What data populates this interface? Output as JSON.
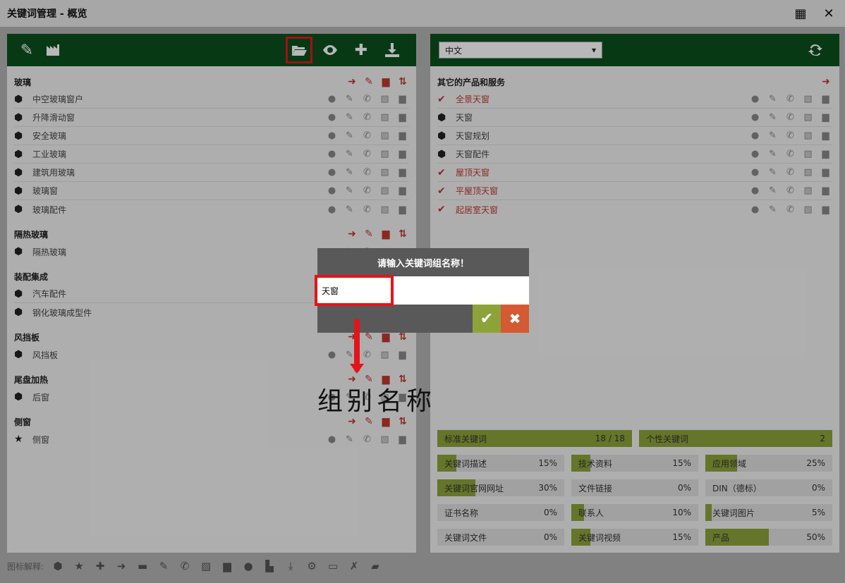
{
  "window": {
    "title": "关键词管理 - 概览"
  },
  "left_groups": [
    {
      "title": "玻璃",
      "items": [
        "中空玻璃窗户",
        "升降滑动窗",
        "安全玻璃",
        "工业玻璃",
        "建筑用玻璃",
        "玻璃窗",
        "玻璃配件"
      ]
    },
    {
      "title": "隔热玻璃",
      "items": [
        "隔热玻璃"
      ]
    },
    {
      "title": "装配集成",
      "items": [
        "汽车配件",
        "钢化玻璃成型件"
      ]
    },
    {
      "title": "风挡板",
      "items": [
        "风挡板"
      ]
    },
    {
      "title": "尾盘加热",
      "items": [
        "后窗"
      ]
    },
    {
      "title": "侧窗",
      "items": [
        "侧窗"
      ]
    }
  ],
  "right": {
    "language": "中文",
    "group_title": "其它的产品和服务",
    "items": [
      {
        "label": "全景天窗",
        "checked": true
      },
      {
        "label": "天窗",
        "checked": false
      },
      {
        "label": "天窗规划",
        "checked": false
      },
      {
        "label": "天窗配件",
        "checked": false
      },
      {
        "label": "屋顶天窗",
        "checked": true
      },
      {
        "label": "平屋顶天窗",
        "checked": true
      },
      {
        "label": "起居室天窗",
        "checked": true
      }
    ]
  },
  "stats": {
    "standard": {
      "label": "标准关键词",
      "value": "18 / 18",
      "fill": 1.0
    },
    "personal": {
      "label": "个性关键词",
      "value": "2",
      "fill": 1.0
    },
    "grid": [
      {
        "label": "关键词描述",
        "value": "15%",
        "fill": 0.15
      },
      {
        "label": "技术资料",
        "value": "15%",
        "fill": 0.15
      },
      {
        "label": "应用领域",
        "value": "25%",
        "fill": 0.25
      },
      {
        "label": "关键词官网网址",
        "value": "30%",
        "fill": 0.3
      },
      {
        "label": "文件链接",
        "value": "0%",
        "fill": 0
      },
      {
        "label": "DIN（德标）",
        "value": "0%",
        "fill": 0
      },
      {
        "label": "证书名称",
        "value": "0%",
        "fill": 0
      },
      {
        "label": "联系人",
        "value": "10%",
        "fill": 0.1
      },
      {
        "label": "关键词图片",
        "value": "5%",
        "fill": 0.05
      },
      {
        "label": "关键词文件",
        "value": "0%",
        "fill": 0
      },
      {
        "label": "关键词视频",
        "value": "15%",
        "fill": 0.15
      },
      {
        "label": "产品",
        "value": "50%",
        "fill": 0.5
      }
    ]
  },
  "legend_label": "图标解释:",
  "dialog": {
    "title": "请输入关键词组名称！",
    "input_value": "天窗"
  },
  "annotation": "组别名称",
  "colors": {
    "toolbar": "#0c4f1e",
    "accent_red": "#c0392b",
    "stat_fill": "#8da33a",
    "highlight": "#e3151a"
  }
}
